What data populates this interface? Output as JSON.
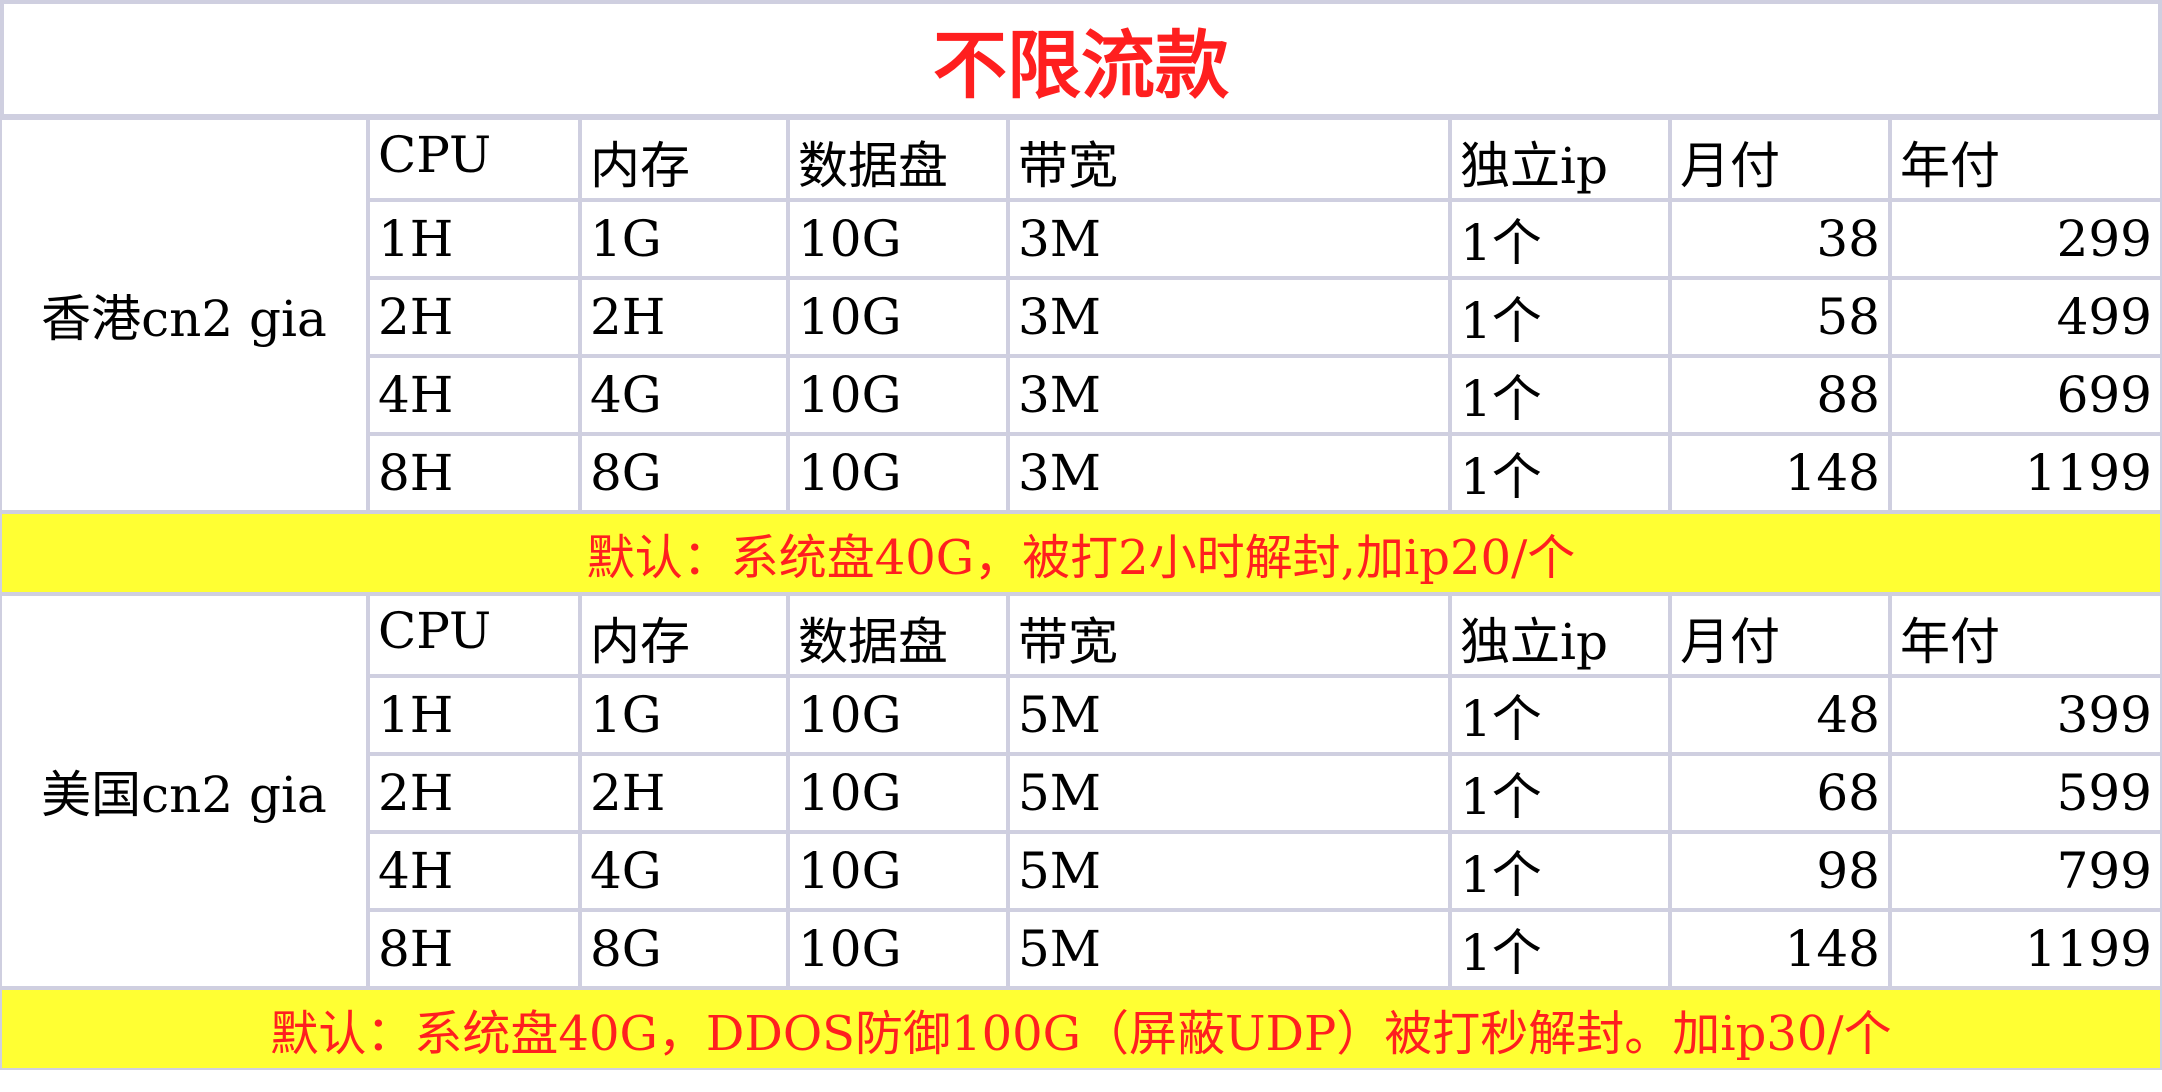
{
  "title": "不限流款",
  "columns": [
    "CPU",
    "内存",
    "数据盘",
    "带宽",
    "独立ip",
    "月付",
    "年付"
  ],
  "sections": [
    {
      "region": "香港cn2 gia",
      "rows": [
        [
          "1H",
          "1G",
          "10G",
          "3M",
          "1个",
          "38",
          "299"
        ],
        [
          "2H",
          "2H",
          "10G",
          "3M",
          "1个",
          "58",
          "499"
        ],
        [
          "4H",
          "4G",
          "10G",
          "3M",
          "1个",
          "88",
          "699"
        ],
        [
          "8H",
          "8G",
          "10G",
          "3M",
          "1个",
          "148",
          "1199"
        ]
      ],
      "note": "默认：系统盘40G，被打2小时解封,加ip20/个"
    },
    {
      "region": "美国cn2 gia",
      "rows": [
        [
          "1H",
          "1G",
          "10G",
          "5M",
          "1个",
          "48",
          "399"
        ],
        [
          "2H",
          "2H",
          "10G",
          "5M",
          "1个",
          "68",
          "599"
        ],
        [
          "4H",
          "4G",
          "10G",
          "5M",
          "1个",
          "98",
          "799"
        ],
        [
          "8H",
          "8G",
          "10G",
          "5M",
          "1个",
          "148",
          "1199"
        ]
      ],
      "note": "默认：系统盘40G，DDOS防御100G（屏蔽UDP）被打秒解封。加ip30/个"
    }
  ],
  "colors": {
    "title": "#ff1f1f",
    "note_bg": "#ffff33",
    "note_text": "#ff1f1f",
    "border": "#cfcfe0"
  }
}
